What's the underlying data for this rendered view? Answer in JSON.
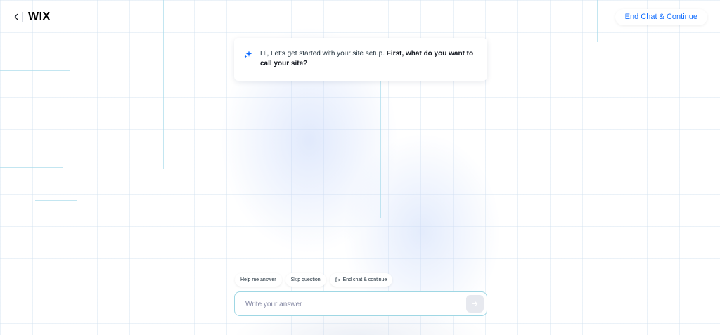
{
  "header": {
    "logo": "WIX",
    "end_chat_label": "End Chat & Continue"
  },
  "message": {
    "intro": "Hi, Let's get started with your site setup. ",
    "question": "First, what do you want to call your site?"
  },
  "chips": [
    {
      "label": "Help me answer"
    },
    {
      "label": "Skip question"
    },
    {
      "label": "End chat & continue"
    }
  ],
  "answer": {
    "placeholder": "Write your answer",
    "value": ""
  },
  "icons": {
    "back": "chevron-left-icon",
    "sparkle": "sparkle-icon",
    "exit": "exit-icon",
    "send": "arrow-right-icon"
  },
  "colors": {
    "accent": "#116dff",
    "input_border": "#9fd7e4",
    "sparkle": "#116dff"
  }
}
